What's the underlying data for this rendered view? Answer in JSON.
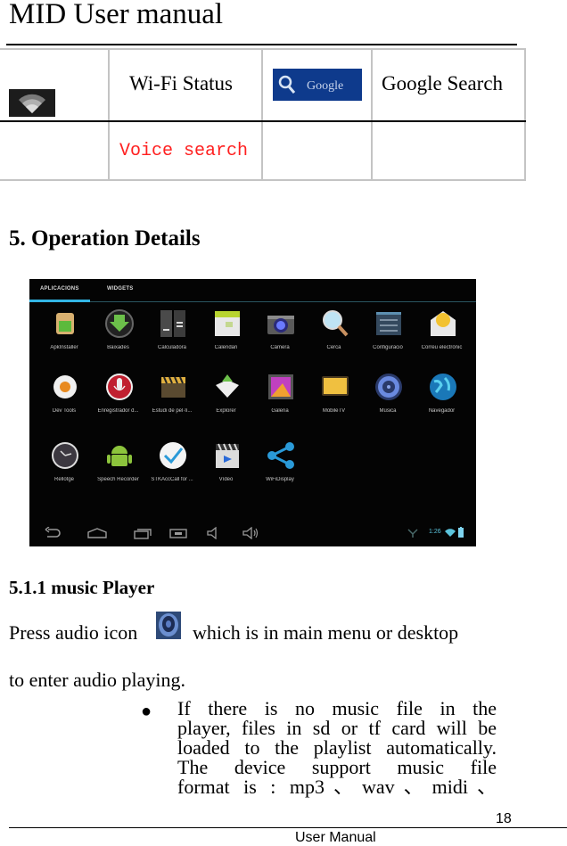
{
  "header": {
    "title": "MID User manual"
  },
  "icon_table": {
    "rows": [
      [
        {
          "type": "icon",
          "icon": "wifi-status-icon"
        },
        {
          "type": "text",
          "text": "Wi-Fi Status"
        },
        {
          "type": "icon",
          "icon": "google-search-icon",
          "icon_text": "Google"
        },
        {
          "type": "text",
          "text": "Google Search"
        }
      ],
      [
        {
          "type": "empty"
        },
        {
          "type": "text",
          "text": "Voice search",
          "color": "#ff2020"
        },
        {
          "type": "empty"
        },
        {
          "type": "empty"
        }
      ]
    ]
  },
  "section": {
    "title": "5. Operation Details"
  },
  "screenshot": {
    "tabs": [
      "APLICACIONS",
      "WIDGETS"
    ],
    "active_tab": "APLICACIONS",
    "accent_color": "#33b5e5",
    "apps": [
      {
        "label": "ApkInstaller",
        "icon": "apk-installer-icon"
      },
      {
        "label": "Baixades",
        "icon": "download-icon"
      },
      {
        "label": "Calculadora",
        "icon": "calculator-icon"
      },
      {
        "label": "Calendari",
        "icon": "calendar-icon"
      },
      {
        "label": "Càmera",
        "icon": "camera-icon"
      },
      {
        "label": "Cerca",
        "icon": "search-icon"
      },
      {
        "label": "Configuració",
        "icon": "settings-icon"
      },
      {
        "label": "Correu electrònic",
        "icon": "email-icon"
      },
      {
        "label": "Dev Tools",
        "icon": "dev-tools-icon"
      },
      {
        "label": "Enregistrador d...",
        "icon": "sound-recorder-icon"
      },
      {
        "label": "Estudi de pel·lí...",
        "icon": "movie-studio-icon"
      },
      {
        "label": "Explorer",
        "icon": "file-explorer-icon"
      },
      {
        "label": "Galeria",
        "icon": "gallery-icon"
      },
      {
        "label": "MobileTV",
        "icon": "mobile-tv-icon"
      },
      {
        "label": "Música",
        "icon": "music-icon"
      },
      {
        "label": "Navegador",
        "icon": "browser-icon"
      },
      {
        "label": "Rellotge",
        "icon": "clock-icon"
      },
      {
        "label": "Speech Recorder",
        "icon": "android-icon"
      },
      {
        "label": "STKAccCall for ...",
        "icon": "checkmark-icon"
      },
      {
        "label": "Vídeo",
        "icon": "video-icon"
      },
      {
        "label": "WiFiDisplay",
        "icon": "share-icon"
      }
    ],
    "nav_buttons": [
      "back-icon",
      "home-icon",
      "recent-apps-icon",
      "screenshot-icon",
      "volume-down-icon",
      "volume-up-icon"
    ],
    "status": {
      "time": "1:26"
    }
  },
  "subsection": {
    "title": "5.1.1 music Player"
  },
  "paragraph": {
    "line1_before_icon": "Press audio icon",
    "line1_after_icon": "which is in main menu or desktop",
    "line2": "to enter audio playing."
  },
  "bullets": [
    {
      "lines": [
        "If there is no music file in the",
        "player, files in sd or tf card will be",
        "loaded to the playlist automatically.",
        "The device support music file",
        "format is : mp3、wav、midi、"
      ]
    }
  ],
  "footer": {
    "page_number": "18",
    "text": "User Manual"
  }
}
